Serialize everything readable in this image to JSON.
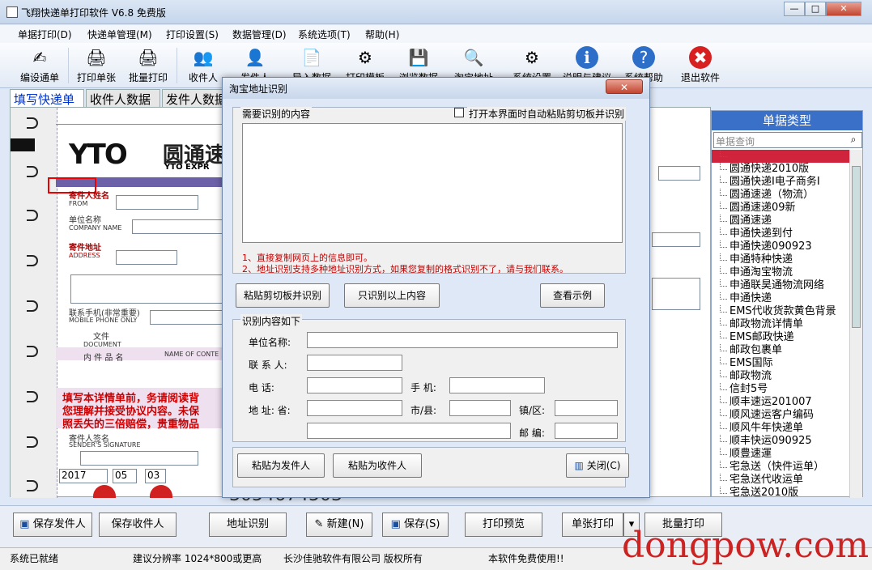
{
  "window": {
    "title": "飞翔快递单打印软件 V6.8 免费版",
    "min": "—",
    "max": "□",
    "close": "✕"
  },
  "menu": [
    "单据打印(D)",
    "快递单管理(M)",
    "打印设置(S)",
    "数据管理(D)",
    "系统选项(T)",
    "帮助(H)"
  ],
  "toolbar": [
    {
      "label": "编设通单",
      "icon": "✍"
    },
    {
      "label": "打印单张",
      "icon": "🖨"
    },
    {
      "label": "批量打印",
      "icon": "🖨"
    },
    {
      "label": "收件人",
      "icon": "👥"
    },
    {
      "label": "发件人",
      "icon": "👤"
    },
    {
      "label": "导入数据",
      "icon": "📄"
    },
    {
      "label": "打印模板",
      "icon": "⚙"
    },
    {
      "label": "浏览数据",
      "icon": "💾"
    },
    {
      "label": "淘宝地址",
      "icon": "🔍"
    },
    {
      "label": "系统设置",
      "icon": "⚙"
    },
    {
      "label": "说明与建议",
      "icon": "ℹ"
    },
    {
      "label": "系统帮助",
      "icon": "?"
    },
    {
      "label": "退出软件",
      "icon": "✖"
    }
  ],
  "tabs": [
    "填写快递单",
    "收件人数据",
    "发件人数据"
  ],
  "form": {
    "logo": "YTO",
    "logo_cn": "圆通速",
    "logo_en": "YTO EXPR",
    "sender_name": "寄件人姓名",
    "from": "FROM",
    "company": "单位名称",
    "company_en": "COMPANY NAME",
    "address": "寄件地址",
    "address_en": "ADDRESS",
    "phone": "联系手机(非常重要)",
    "mobile_en": "MOBILE PHONE ONLY",
    "doc": "文件",
    "doc_en": "DOCUMENT",
    "item": "内 件 品 名",
    "item_en": "NAME OF CONTE",
    "notice1": "填写本详情单前，务请阅读背",
    "notice2": "您理解并接受协议内容。未保",
    "notice3": "照丢失的三倍赔偿，贵重物品",
    "signature": "寄件人签名",
    "signature_en": "SENDER'S SIGNATURE",
    "year": "2017",
    "month": "05",
    "day": "03",
    "tracking": "3054674503"
  },
  "right_panel": {
    "title": "单据类型",
    "search_placeholder": "单据查询",
    "items": [
      "",
      "圆通快递2010版",
      "圆通快递I电子商务I",
      "圆通速递（物流）",
      "圆通速递09新",
      "圆通速递",
      "申通快递到付",
      "申通快递090923",
      "申通特种快递",
      "申通淘宝物流",
      "申通联昊通物流网络",
      "申通快递",
      "EMS代收货款黄色背景",
      "邮政物流详情单",
      "EMS邮政快递",
      "邮政包裹单",
      "EMS国际",
      "邮政物流",
      "信封5号",
      "顺丰速运201007",
      "顺风速运客户编码",
      "顺风牛年快递单",
      "顺丰快运090925",
      "顺豊速運",
      "宅急送（快件运单）",
      "宅急送代收运单",
      "宅急送2010版"
    ]
  },
  "bottom": {
    "save_sender": "保存发件人",
    "save_receiver": "保存收件人",
    "addr_recog": "地址识别",
    "new": "新建(N)",
    "save": "保存(S)",
    "preview": "打印预览",
    "single_print": "单张打印",
    "batch_print": "批量打印"
  },
  "status": {
    "ready": "系统已就绪",
    "resolution": "建议分辨率 1024*800或更高",
    "company": "长沙佳驰软件有限公司 版权所有",
    "free": "本软件免费使用!!"
  },
  "watermark": "dongpow.com",
  "dialog": {
    "title": "淘宝地址识别",
    "content_label": "需要识别的内容",
    "auto_checkbox": "打开本界面时自动粘贴剪切板并识别",
    "note1": "1、直接复制网页上的信息即可。",
    "note2": "2、地址识别支持多种地址识别方式，如果您复制的格式识别不了，请与我们联系。",
    "btn_paste_recog": "粘贴剪切板并识别",
    "btn_only_recog": "只识别以上内容",
    "btn_example": "查看示例",
    "result_label": "识别内容如下",
    "unit_label": "单位名称:",
    "contact_label": "联 系 人:",
    "phone_label": "电    话:",
    "mobile_label": "手 机:",
    "address_label": "地    址: 省:",
    "city_label": "市/县:",
    "town_label": "镇/区:",
    "zip_label": "邮 编:",
    "btn_paste_sender": "粘贴为发件人",
    "btn_paste_receiver": "粘贴为收件人",
    "btn_close": "关闭(C)"
  }
}
